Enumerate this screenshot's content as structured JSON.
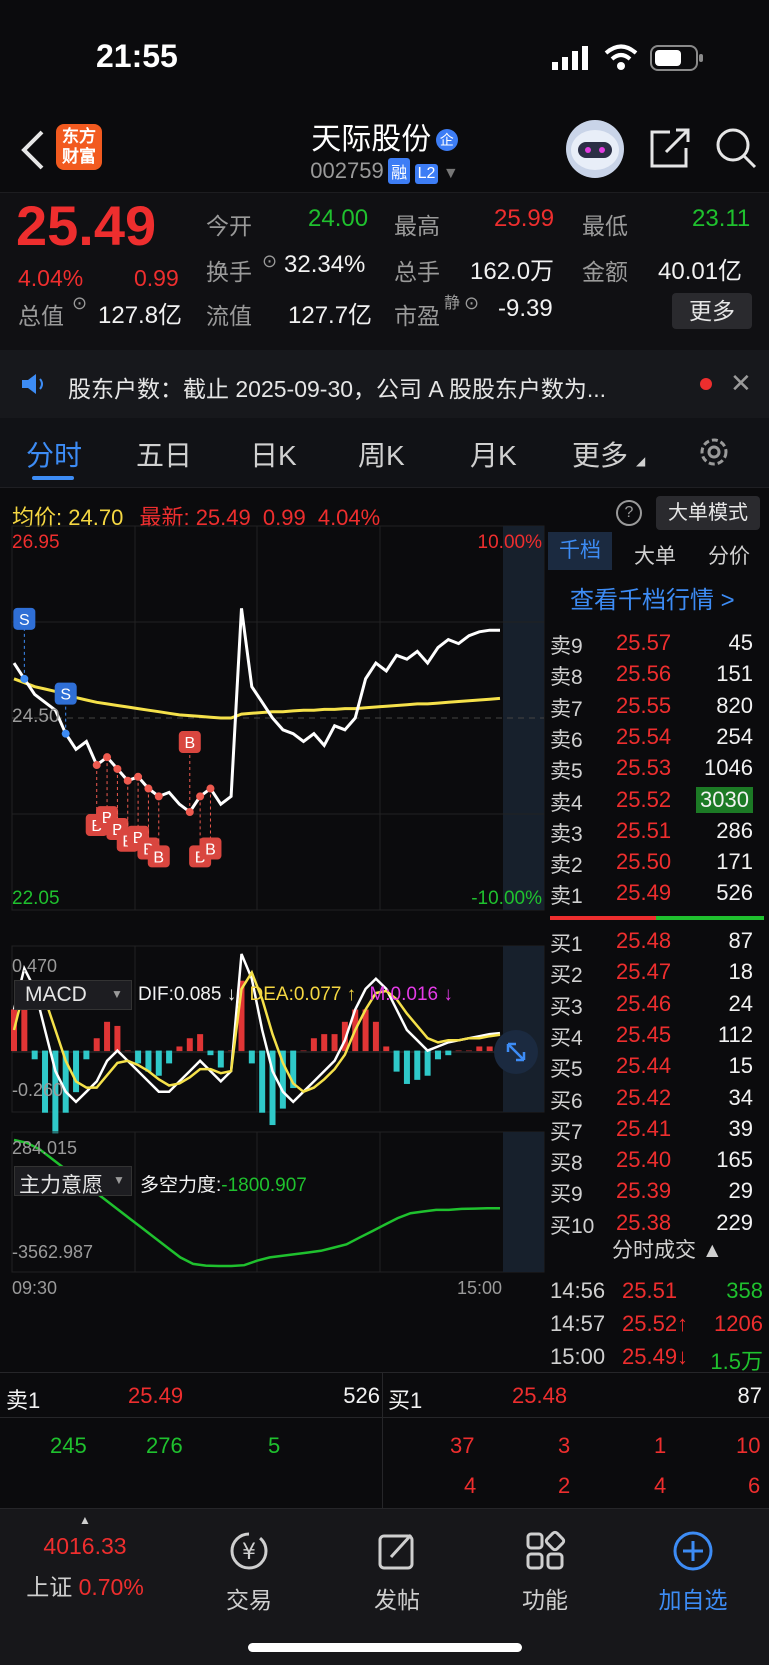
{
  "status_bar": {
    "time": "21:55"
  },
  "header": {
    "logo_line1": "东方",
    "logo_line2": "财富",
    "stock_name": "天际股份",
    "badge_qi": "企",
    "code": "002759",
    "badge_rong": "融",
    "badge_l2": "L2"
  },
  "quote": {
    "price": "25.49",
    "change_pct": "4.04%",
    "change": "0.99",
    "open_label": "今开",
    "open": "24.00",
    "high_label": "最高",
    "high": "25.99",
    "low_label": "最低",
    "low": "23.11",
    "turnover_label": "换手",
    "turnover": "32.34%",
    "volume_label": "总手",
    "volume": "162.0万",
    "amount_label": "金额",
    "amount": "40.01亿",
    "mktcap_label": "总值",
    "mktcap": "127.8亿",
    "float_label": "流值",
    "float": "127.7亿",
    "pe_label": "市盈",
    "pe_sup": "静",
    "pe": "-9.39",
    "more": "更多"
  },
  "notice": {
    "text": "股东户数：截止 2025-09-30，公司 A 股股东户数为..."
  },
  "tabs": {
    "t1": "分时",
    "t2": "五日",
    "t3": "日K",
    "t4": "周K",
    "t5": "月K",
    "t6": "更多"
  },
  "info_line": {
    "avg_label": "均价:",
    "avg": "24.70",
    "last_label": "最新:",
    "last": "25.49",
    "chg": "0.99",
    "pct": "4.04%",
    "mode_btn": "大单模式"
  },
  "chart_data": {
    "type": "line",
    "title": "",
    "ylim": [
      22.05,
      26.95
    ],
    "y_top_label": "26.95",
    "y_bottom_label": "22.05",
    "pct_top_label": "10.00%",
    "pct_bottom_label": "-10.00%",
    "mid_label": "24.50",
    "x_start_label": "09:30",
    "x_end_label": "15:00",
    "price_series": [
      25.2,
      25.0,
      24.8,
      24.7,
      24.6,
      24.3,
      24.1,
      24.2,
      23.9,
      24.0,
      23.85,
      23.7,
      23.75,
      23.6,
      23.5,
      23.55,
      23.4,
      23.3,
      23.5,
      23.6,
      23.4,
      23.5,
      25.9,
      24.9,
      24.7,
      24.5,
      24.35,
      24.3,
      24.2,
      24.3,
      24.15,
      24.4,
      24.35,
      24.5,
      25.0,
      25.2,
      25.1,
      25.3,
      25.25,
      25.35,
      25.2,
      25.4,
      25.5,
      25.45,
      25.55,
      25.6,
      25.62,
      25.62
    ],
    "avg_series": [
      25.0,
      24.95,
      24.9,
      24.87,
      24.84,
      24.8,
      24.76,
      24.73,
      24.7,
      24.68,
      24.66,
      24.64,
      24.62,
      24.6,
      24.58,
      24.56,
      24.54,
      24.53,
      24.52,
      24.51,
      24.5,
      24.5,
      24.55,
      24.56,
      24.57,
      24.58,
      24.58,
      24.59,
      24.6,
      24.6,
      24.61,
      24.61,
      24.62,
      24.62,
      24.63,
      24.64,
      24.65,
      24.66,
      24.67,
      24.68,
      24.68,
      24.69,
      24.7,
      24.71,
      24.72,
      24.73,
      24.74,
      24.75
    ],
    "sell_markers": [
      "S",
      "S"
    ],
    "buy_markers": [
      "B",
      "B",
      "B",
      "B",
      "B",
      "B",
      "B",
      "B",
      "B",
      "B"
    ]
  },
  "macd": {
    "name": "MACD",
    "dif": "DIF:0.085 ↓",
    "dea": "DEA:0.077 ↑",
    "m": "M:0.016 ↓",
    "top": "0.470",
    "bottom": "-0.260",
    "dif_series": [
      0.2,
      0.4,
      0.3,
      0.1,
      -0.1,
      -0.2,
      -0.25,
      -0.2,
      -0.15,
      -0.05,
      0.0,
      -0.05,
      -0.1,
      -0.15,
      -0.2,
      -0.2,
      -0.15,
      -0.1,
      -0.05,
      -0.1,
      -0.15,
      -0.1,
      0.47,
      0.35,
      0.1,
      -0.1,
      -0.2,
      -0.25,
      -0.2,
      -0.15,
      -0.1,
      -0.05,
      0.05,
      0.2,
      0.3,
      0.35,
      0.3,
      0.2,
      0.1,
      0.05,
      0.0,
      0.02,
      0.04,
      0.05,
      0.06,
      0.07,
      0.08,
      0.085
    ],
    "dea_series": [
      0.1,
      0.3,
      0.32,
      0.25,
      0.1,
      -0.05,
      -0.15,
      -0.18,
      -0.18,
      -0.12,
      -0.06,
      -0.05,
      -0.07,
      -0.1,
      -0.14,
      -0.17,
      -0.16,
      -0.13,
      -0.09,
      -0.09,
      -0.11,
      -0.1,
      0.3,
      0.38,
      0.25,
      0.08,
      -0.06,
      -0.16,
      -0.2,
      -0.18,
      -0.14,
      -0.09,
      -0.02,
      0.1,
      0.2,
      0.28,
      0.29,
      0.25,
      0.18,
      0.12,
      0.06,
      0.04,
      0.05,
      0.05,
      0.06,
      0.06,
      0.07,
      0.077
    ]
  },
  "zhuli": {
    "name": "主力意愿",
    "label": "多空力度:",
    "value": "-1800.907",
    "top": "284.015",
    "bottom": "-3562.987",
    "series": [
      284,
      200,
      0,
      -300,
      -600,
      -900,
      -1200,
      -1500,
      -1800,
      -2100,
      -2400,
      -2700,
      -3000,
      -3300,
      -3500,
      -3550,
      -3562,
      -3562,
      -3540,
      -3400,
      -3300,
      -3250,
      -3200,
      -3150,
      -3100,
      -3000,
      -2900,
      -2700,
      -2500,
      -2300,
      -2100,
      -1950,
      -1900,
      -1850,
      -1850,
      -1820,
      -1810,
      -1800,
      -1800
    ]
  },
  "depth": {
    "tabs": {
      "t1": "千档",
      "t2": "大单",
      "t3": "分价"
    },
    "link": "查看千档行情 >",
    "asks": [
      {
        "label": "卖9",
        "price": "25.57",
        "vol": "45"
      },
      {
        "label": "卖8",
        "price": "25.56",
        "vol": "151"
      },
      {
        "label": "卖7",
        "price": "25.55",
        "vol": "820"
      },
      {
        "label": "卖6",
        "price": "25.54",
        "vol": "254"
      },
      {
        "label": "卖5",
        "price": "25.53",
        "vol": "1046"
      },
      {
        "label": "卖4",
        "price": "25.52",
        "vol": "3030"
      },
      {
        "label": "卖3",
        "price": "25.51",
        "vol": "286"
      },
      {
        "label": "卖2",
        "price": "25.50",
        "vol": "171"
      },
      {
        "label": "卖1",
        "price": "25.49",
        "vol": "526"
      }
    ],
    "bids": [
      {
        "label": "买1",
        "price": "25.48",
        "vol": "87"
      },
      {
        "label": "买2",
        "price": "25.47",
        "vol": "18"
      },
      {
        "label": "买3",
        "price": "25.46",
        "vol": "24"
      },
      {
        "label": "买4",
        "price": "25.45",
        "vol": "112"
      },
      {
        "label": "买5",
        "price": "25.44",
        "vol": "15"
      },
      {
        "label": "买6",
        "price": "25.42",
        "vol": "34"
      },
      {
        "label": "买7",
        "price": "25.41",
        "vol": "39"
      },
      {
        "label": "买8",
        "price": "25.40",
        "vol": "165"
      },
      {
        "label": "买9",
        "price": "25.39",
        "vol": "29"
      },
      {
        "label": "买10",
        "price": "25.38",
        "vol": "229"
      }
    ],
    "trades_title": "分时成交 ▲",
    "trades": [
      {
        "time": "14:56",
        "price": "25.51",
        "vol": "358"
      },
      {
        "time": "14:57",
        "price": "25.52↑",
        "vol": "1206"
      },
      {
        "time": "15:00",
        "price": "25.49↓",
        "vol": "1.5万"
      }
    ]
  },
  "level1": {
    "sell_label": "卖1",
    "sell_price": "25.49",
    "sell_vol": "526",
    "buy_label": "买1",
    "buy_price": "25.48",
    "buy_vol": "87",
    "left_row": [
      "245",
      "276",
      "5"
    ],
    "right_row1": [
      "37",
      "3",
      "1",
      "10"
    ],
    "right_row2": [
      "4",
      "2",
      "4",
      "6"
    ]
  },
  "bottom_nav": {
    "index_value": "4016.33",
    "index_name": "上证",
    "index_pct": "0.70%",
    "trade": "交易",
    "post": "发帖",
    "func": "功能",
    "add": "加自选"
  }
}
